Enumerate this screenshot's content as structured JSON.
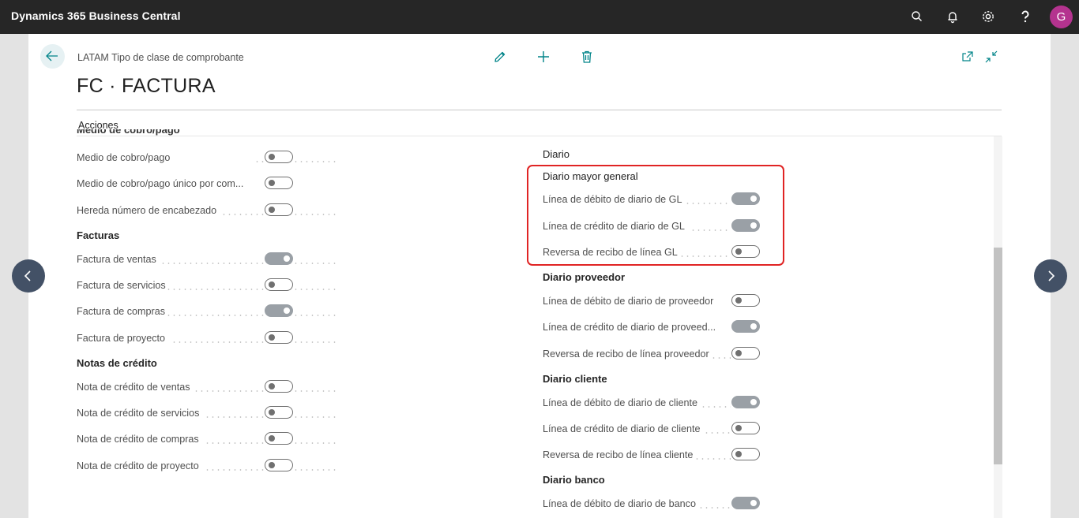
{
  "app": {
    "title": "Dynamics 365 Business Central",
    "user_initial": "G"
  },
  "colors": {
    "accent": "#008489",
    "topbar": "#262626",
    "avatar": "#b4338f",
    "highlight": "#e02424",
    "nav": "#435166"
  },
  "icons": [
    "search-icon",
    "bell-icon",
    "gear-icon",
    "help-icon",
    "back-arrow-icon",
    "edit-icon",
    "plus-icon",
    "delete-icon",
    "open-new-window-icon",
    "collapse-icon",
    "chevron-left-icon",
    "chevron-right-icon"
  ],
  "page": {
    "breadcrumb": "LATAM Tipo de clase de comprobante",
    "title": "FC · FACTURA",
    "actions_label": "Acciones",
    "partial_heading": "Medio de cobro/pago"
  },
  "left": {
    "rows_top": [
      {
        "label": "Medio de cobro/pago",
        "on": false
      },
      {
        "label": "Medio de cobro/pago único por com...",
        "on": false
      },
      {
        "label": "Hereda número de encabezado",
        "on": false
      }
    ],
    "facturas": {
      "title": "Facturas",
      "rows": [
        {
          "label": "Factura de ventas",
          "on": true
        },
        {
          "label": "Factura de servicios",
          "on": false
        },
        {
          "label": "Factura de compras",
          "on": true
        },
        {
          "label": "Factura de proyecto",
          "on": false
        }
      ]
    },
    "notas": {
      "title": "Notas de crédito",
      "rows": [
        {
          "label": "Nota de crédito de ventas",
          "on": false
        },
        {
          "label": "Nota de crédito de servicios",
          "on": false
        },
        {
          "label": "Nota de crédito de compras",
          "on": false
        },
        {
          "label": "Nota de crédito de proyecto",
          "on": false
        }
      ]
    }
  },
  "right": {
    "diario_title": "Diario",
    "gl": {
      "title": "Diario mayor general",
      "rows": [
        {
          "label": "Línea de débito de diario de GL",
          "on": true
        },
        {
          "label": "Línea de crédito de diario de GL",
          "on": true
        },
        {
          "label": "Reversa de recibo de línea GL",
          "on": false
        }
      ]
    },
    "proveedor": {
      "title": "Diario proveedor",
      "rows": [
        {
          "label": "Línea de débito de diario de proveedor",
          "on": false
        },
        {
          "label": "Línea de crédito de diario de proveed...",
          "on": true
        },
        {
          "label": "Reversa de recibo de línea proveedor",
          "on": false
        }
      ]
    },
    "cliente": {
      "title": "Diario cliente",
      "rows": [
        {
          "label": "Línea de débito de diario de cliente",
          "on": true
        },
        {
          "label": "Línea de crédito de diario de cliente",
          "on": false
        },
        {
          "label": "Reversa de recibo de línea cliente",
          "on": false
        }
      ]
    },
    "banco": {
      "title": "Diario banco",
      "rows": [
        {
          "label": "Línea de débito de diario de banco",
          "on": true
        }
      ]
    }
  }
}
